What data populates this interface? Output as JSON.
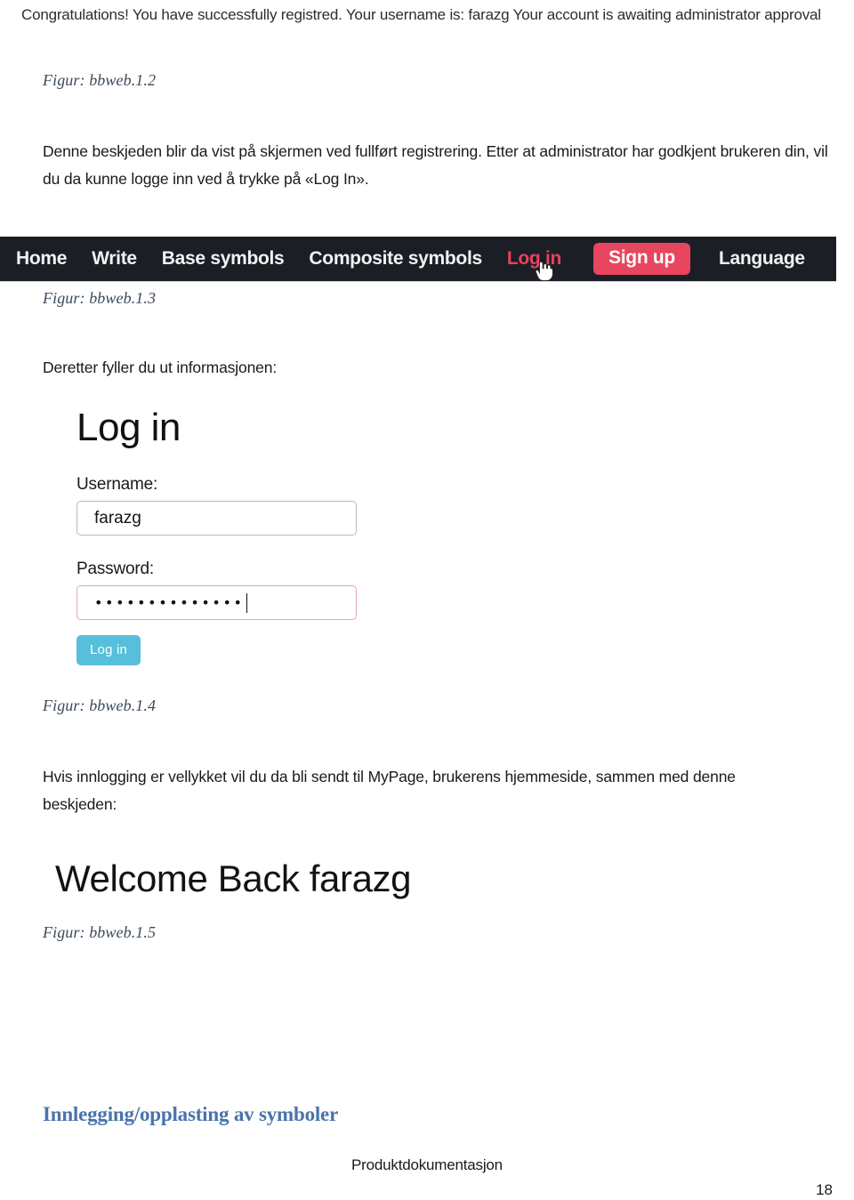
{
  "document": {
    "footer_text": "Produktdokumentasjon",
    "page_number": "18",
    "section_heading": "Innlegging/opplasting av symboler"
  },
  "figure_1_2": {
    "caption": "Figur: bbweb.1.2",
    "screenshot": {
      "message": "Congratulations! You have successfully registred. Your username is: farazg Your account is awaiting administrator approval"
    }
  },
  "body_1": {
    "text": "Denne beskjeden blir da vist på skjermen ved fullført registrering. Etter at administrator har godkjent brukeren din, vil du da kunne logge inn ved å trykke på «Log In»."
  },
  "figure_1_3": {
    "caption": "Figur: bbweb.1.3",
    "screenshot": {
      "navbar": {
        "background_color": "#1c1e26",
        "link_color": "#f2f2f2",
        "active_link_color": "#e8415c",
        "signup_button_color": "#e8455f",
        "items": [
          {
            "label": "Home",
            "type": "link",
            "state": "normal"
          },
          {
            "label": "Write",
            "type": "link",
            "state": "normal"
          },
          {
            "label": "Base symbols",
            "type": "link",
            "state": "normal"
          },
          {
            "label": "Composite symbols",
            "type": "link",
            "state": "normal"
          },
          {
            "label": "Log in",
            "type": "link",
            "state": "hovered"
          },
          {
            "label": "Sign up",
            "type": "button",
            "state": "normal"
          },
          {
            "label": "Language",
            "type": "link",
            "state": "normal"
          }
        ],
        "cursor": "pointer-hand-cursor"
      }
    }
  },
  "body_2": {
    "text": "Deretter fyller du ut informasjonen:"
  },
  "figure_1_4": {
    "caption": "Figur: bbweb.1.4",
    "screenshot": {
      "title": "Log in",
      "username": {
        "label": "Username:",
        "value": "farazg"
      },
      "password": {
        "label": "Password:",
        "value": "••••••••••••••",
        "focused": true,
        "border_color": "#e0a7b4"
      },
      "submit": {
        "label": "Log in",
        "color": "#57bfdb"
      }
    }
  },
  "body_3": {
    "text": "Hvis innlogging er vellykket vil du da bli sendt til MyPage, brukerens hjemmeside, sammen med denne beskjeden:"
  },
  "figure_1_5": {
    "caption": "Figur: bbweb.1.5",
    "screenshot": {
      "heading": "Welcome Back farazg"
    }
  }
}
